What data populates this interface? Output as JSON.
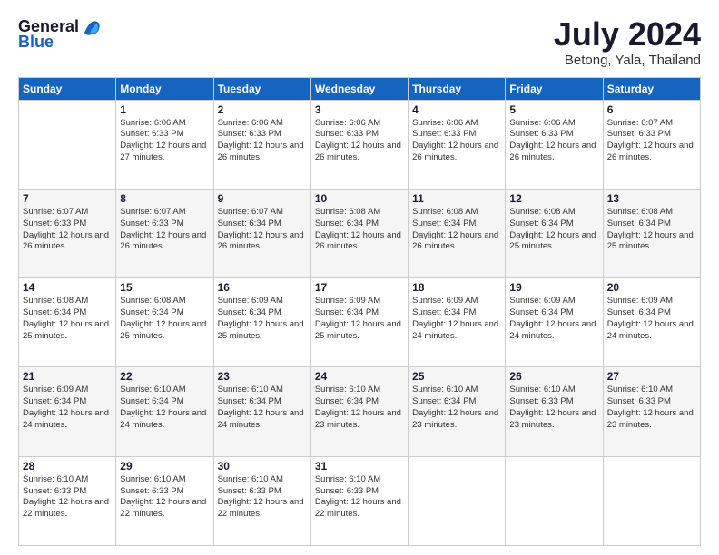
{
  "header": {
    "logo_general": "General",
    "logo_blue": "Blue",
    "month_year": "July 2024",
    "location": "Betong, Yala, Thailand"
  },
  "days_of_week": [
    "Sunday",
    "Monday",
    "Tuesday",
    "Wednesday",
    "Thursday",
    "Friday",
    "Saturday"
  ],
  "weeks": [
    [
      {
        "day": "",
        "sunrise": "",
        "sunset": "",
        "daylight": ""
      },
      {
        "day": "1",
        "sunrise": "Sunrise: 6:06 AM",
        "sunset": "Sunset: 6:33 PM",
        "daylight": "Daylight: 12 hours and 27 minutes."
      },
      {
        "day": "2",
        "sunrise": "Sunrise: 6:06 AM",
        "sunset": "Sunset: 6:33 PM",
        "daylight": "Daylight: 12 hours and 26 minutes."
      },
      {
        "day": "3",
        "sunrise": "Sunrise: 6:06 AM",
        "sunset": "Sunset: 6:33 PM",
        "daylight": "Daylight: 12 hours and 26 minutes."
      },
      {
        "day": "4",
        "sunrise": "Sunrise: 6:06 AM",
        "sunset": "Sunset: 6:33 PM",
        "daylight": "Daylight: 12 hours and 26 minutes."
      },
      {
        "day": "5",
        "sunrise": "Sunrise: 6:06 AM",
        "sunset": "Sunset: 6:33 PM",
        "daylight": "Daylight: 12 hours and 26 minutes."
      },
      {
        "day": "6",
        "sunrise": "Sunrise: 6:07 AM",
        "sunset": "Sunset: 6:33 PM",
        "daylight": "Daylight: 12 hours and 26 minutes."
      }
    ],
    [
      {
        "day": "7",
        "sunrise": "Sunrise: 6:07 AM",
        "sunset": "Sunset: 6:33 PM",
        "daylight": "Daylight: 12 hours and 26 minutes."
      },
      {
        "day": "8",
        "sunrise": "Sunrise: 6:07 AM",
        "sunset": "Sunset: 6:33 PM",
        "daylight": "Daylight: 12 hours and 26 minutes."
      },
      {
        "day": "9",
        "sunrise": "Sunrise: 6:07 AM",
        "sunset": "Sunset: 6:34 PM",
        "daylight": "Daylight: 12 hours and 26 minutes."
      },
      {
        "day": "10",
        "sunrise": "Sunrise: 6:08 AM",
        "sunset": "Sunset: 6:34 PM",
        "daylight": "Daylight: 12 hours and 26 minutes."
      },
      {
        "day": "11",
        "sunrise": "Sunrise: 6:08 AM",
        "sunset": "Sunset: 6:34 PM",
        "daylight": "Daylight: 12 hours and 26 minutes."
      },
      {
        "day": "12",
        "sunrise": "Sunrise: 6:08 AM",
        "sunset": "Sunset: 6:34 PM",
        "daylight": "Daylight: 12 hours and 25 minutes."
      },
      {
        "day": "13",
        "sunrise": "Sunrise: 6:08 AM",
        "sunset": "Sunset: 6:34 PM",
        "daylight": "Daylight: 12 hours and 25 minutes."
      }
    ],
    [
      {
        "day": "14",
        "sunrise": "Sunrise: 6:08 AM",
        "sunset": "Sunset: 6:34 PM",
        "daylight": "Daylight: 12 hours and 25 minutes."
      },
      {
        "day": "15",
        "sunrise": "Sunrise: 6:08 AM",
        "sunset": "Sunset: 6:34 PM",
        "daylight": "Daylight: 12 hours and 25 minutes."
      },
      {
        "day": "16",
        "sunrise": "Sunrise: 6:09 AM",
        "sunset": "Sunset: 6:34 PM",
        "daylight": "Daylight: 12 hours and 25 minutes."
      },
      {
        "day": "17",
        "sunrise": "Sunrise: 6:09 AM",
        "sunset": "Sunset: 6:34 PM",
        "daylight": "Daylight: 12 hours and 25 minutes."
      },
      {
        "day": "18",
        "sunrise": "Sunrise: 6:09 AM",
        "sunset": "Sunset: 6:34 PM",
        "daylight": "Daylight: 12 hours and 24 minutes."
      },
      {
        "day": "19",
        "sunrise": "Sunrise: 6:09 AM",
        "sunset": "Sunset: 6:34 PM",
        "daylight": "Daylight: 12 hours and 24 minutes."
      },
      {
        "day": "20",
        "sunrise": "Sunrise: 6:09 AM",
        "sunset": "Sunset: 6:34 PM",
        "daylight": "Daylight: 12 hours and 24 minutes."
      }
    ],
    [
      {
        "day": "21",
        "sunrise": "Sunrise: 6:09 AM",
        "sunset": "Sunset: 6:34 PM",
        "daylight": "Daylight: 12 hours and 24 minutes."
      },
      {
        "day": "22",
        "sunrise": "Sunrise: 6:10 AM",
        "sunset": "Sunset: 6:34 PM",
        "daylight": "Daylight: 12 hours and 24 minutes."
      },
      {
        "day": "23",
        "sunrise": "Sunrise: 6:10 AM",
        "sunset": "Sunset: 6:34 PM",
        "daylight": "Daylight: 12 hours and 24 minutes."
      },
      {
        "day": "24",
        "sunrise": "Sunrise: 6:10 AM",
        "sunset": "Sunset: 6:34 PM",
        "daylight": "Daylight: 12 hours and 23 minutes."
      },
      {
        "day": "25",
        "sunrise": "Sunrise: 6:10 AM",
        "sunset": "Sunset: 6:34 PM",
        "daylight": "Daylight: 12 hours and 23 minutes."
      },
      {
        "day": "26",
        "sunrise": "Sunrise: 6:10 AM",
        "sunset": "Sunset: 6:33 PM",
        "daylight": "Daylight: 12 hours and 23 minutes."
      },
      {
        "day": "27",
        "sunrise": "Sunrise: 6:10 AM",
        "sunset": "Sunset: 6:33 PM",
        "daylight": "Daylight: 12 hours and 23 minutes."
      }
    ],
    [
      {
        "day": "28",
        "sunrise": "Sunrise: 6:10 AM",
        "sunset": "Sunset: 6:33 PM",
        "daylight": "Daylight: 12 hours and 22 minutes."
      },
      {
        "day": "29",
        "sunrise": "Sunrise: 6:10 AM",
        "sunset": "Sunset: 6:33 PM",
        "daylight": "Daylight: 12 hours and 22 minutes."
      },
      {
        "day": "30",
        "sunrise": "Sunrise: 6:10 AM",
        "sunset": "Sunset: 6:33 PM",
        "daylight": "Daylight: 12 hours and 22 minutes."
      },
      {
        "day": "31",
        "sunrise": "Sunrise: 6:10 AM",
        "sunset": "Sunset: 6:33 PM",
        "daylight": "Daylight: 12 hours and 22 minutes."
      },
      {
        "day": "",
        "sunrise": "",
        "sunset": "",
        "daylight": ""
      },
      {
        "day": "",
        "sunrise": "",
        "sunset": "",
        "daylight": ""
      },
      {
        "day": "",
        "sunrise": "",
        "sunset": "",
        "daylight": ""
      }
    ]
  ]
}
